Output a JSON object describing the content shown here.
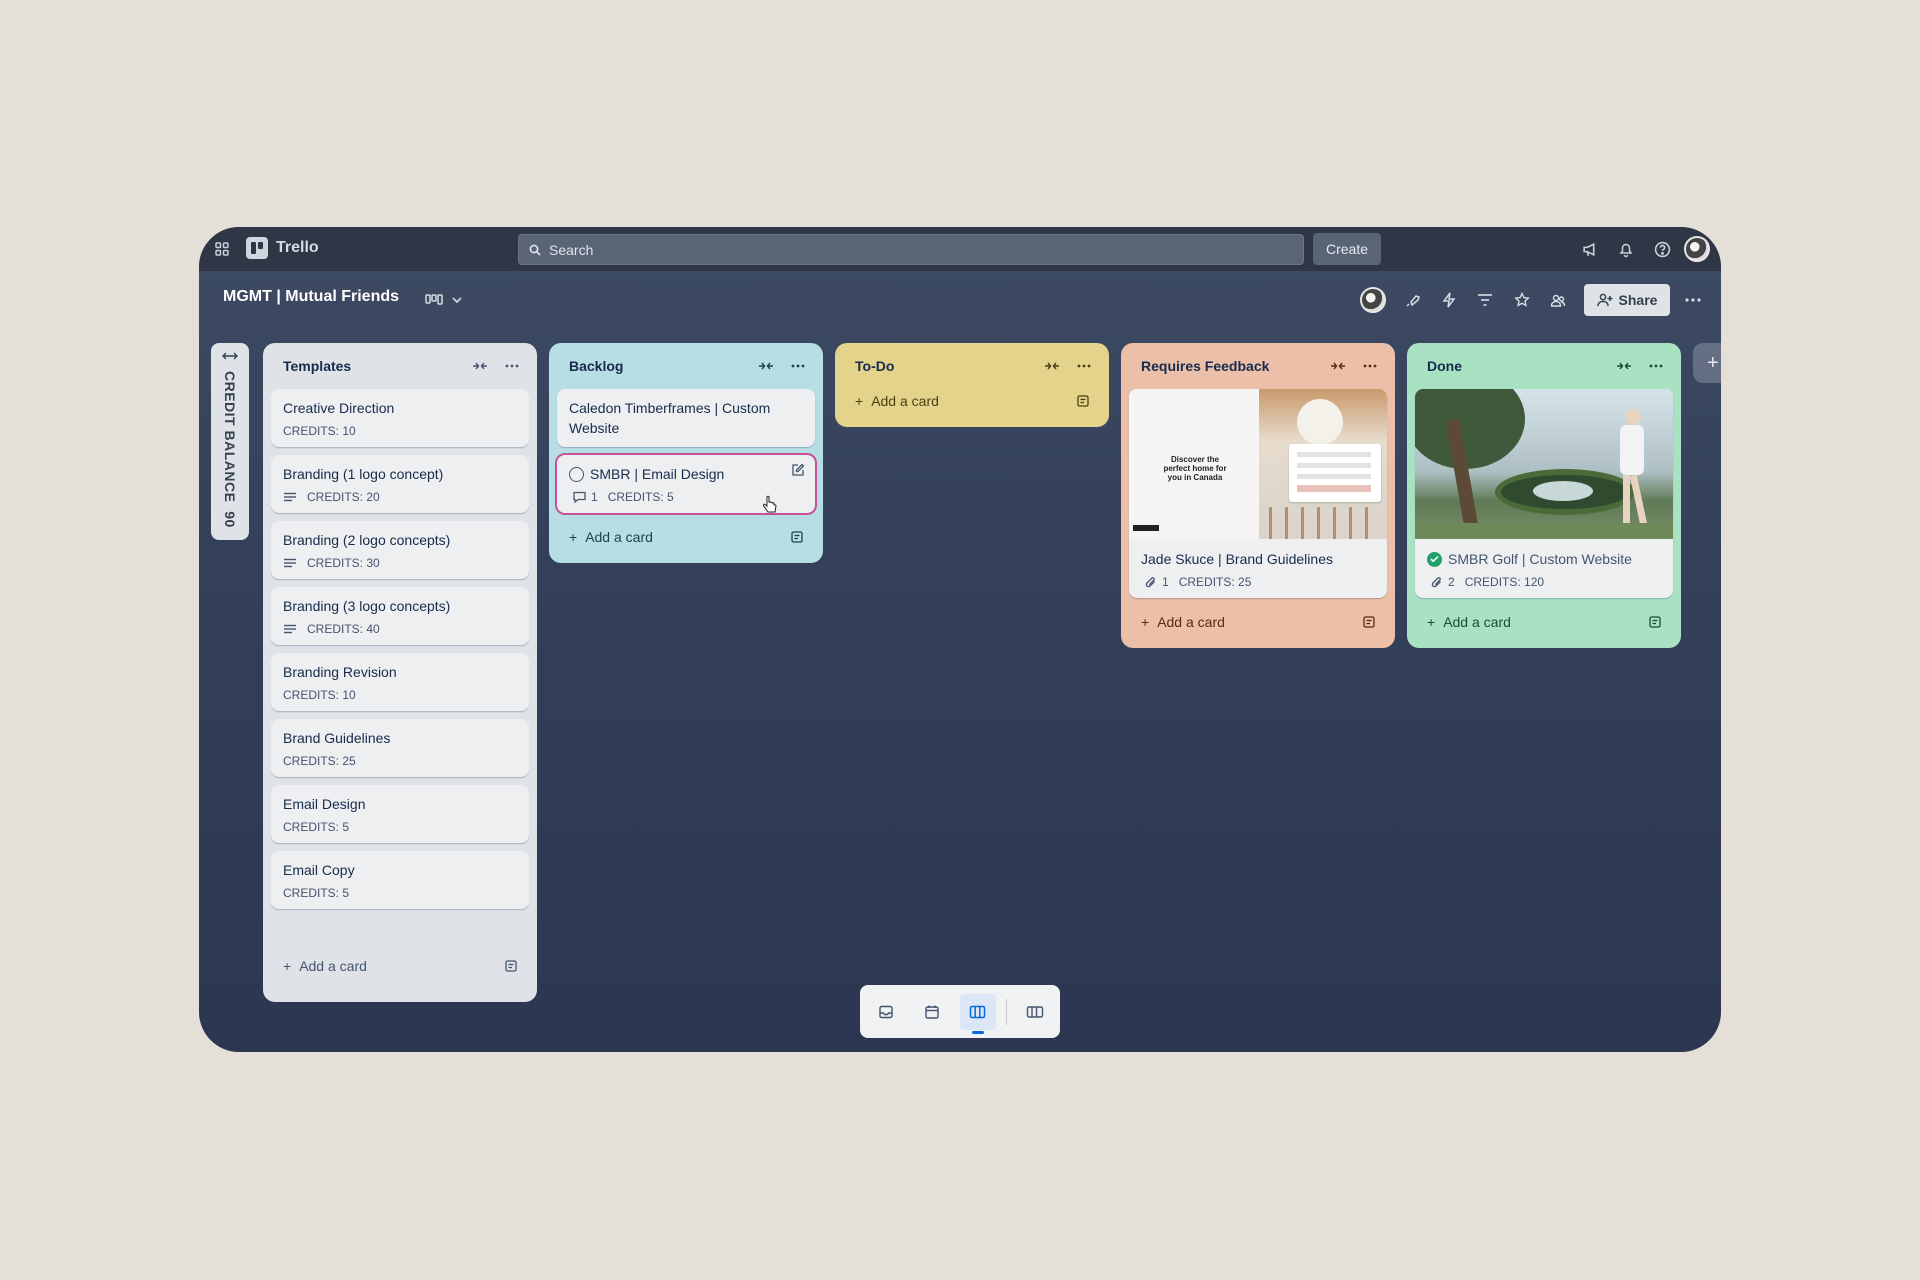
{
  "app": {
    "name": "Trello"
  },
  "topbar": {
    "search_placeholder": "Search",
    "create_label": "Create"
  },
  "board": {
    "title": "MGMT | Mutual Friends",
    "share_label": "Share"
  },
  "credit_balance": {
    "label": "CREDIT BALANCE",
    "value": "90"
  },
  "lists": [
    {
      "name": "Templates",
      "add_label": "Add a card",
      "cards": [
        {
          "title": "Creative Direction",
          "credits": "CREDITS: 10"
        },
        {
          "title": "Branding (1 logo concept)",
          "credits": "CREDITS: 20"
        },
        {
          "title": "Branding (2 logo concepts)",
          "credits": "CREDITS: 30"
        },
        {
          "title": "Branding (3 logo concepts)",
          "credits": "CREDITS: 40"
        },
        {
          "title": "Branding Revision",
          "credits": "CREDITS: 10"
        },
        {
          "title": "Brand Guidelines",
          "credits": "CREDITS: 25"
        },
        {
          "title": "Email Design",
          "credits": "CREDITS: 5"
        },
        {
          "title": "Email Copy",
          "credits": "CREDITS: 5"
        }
      ]
    },
    {
      "name": "Backlog",
      "add_label": "Add a card",
      "cards": [
        {
          "title": "Caledon Timberframes | Custom Website"
        },
        {
          "title": "SMBR | Email Design",
          "comments": "1",
          "credits": "CREDITS: 5"
        }
      ]
    },
    {
      "name": "To-Do",
      "add_label": "Add a card"
    },
    {
      "name": "Requires Feedback",
      "add_label": "Add a card",
      "cards": [
        {
          "title": "Jade Skuce | Brand Guidelines",
          "attachments": "1",
          "credits": "CREDITS: 25",
          "cover_text": "Discover the perfect home for you in Canada"
        }
      ]
    },
    {
      "name": "Done",
      "add_label": "Add a card",
      "cards": [
        {
          "title": "SMBR Golf | Custom Website",
          "attachments": "2",
          "credits": "CREDITS: 120"
        }
      ]
    }
  ],
  "colors": {
    "templates": "#dfe3e8",
    "backlog": "#b7dde5",
    "todo": "#e3d38b",
    "feedback": "#ebbfa8",
    "done": "#a9e2c3"
  }
}
